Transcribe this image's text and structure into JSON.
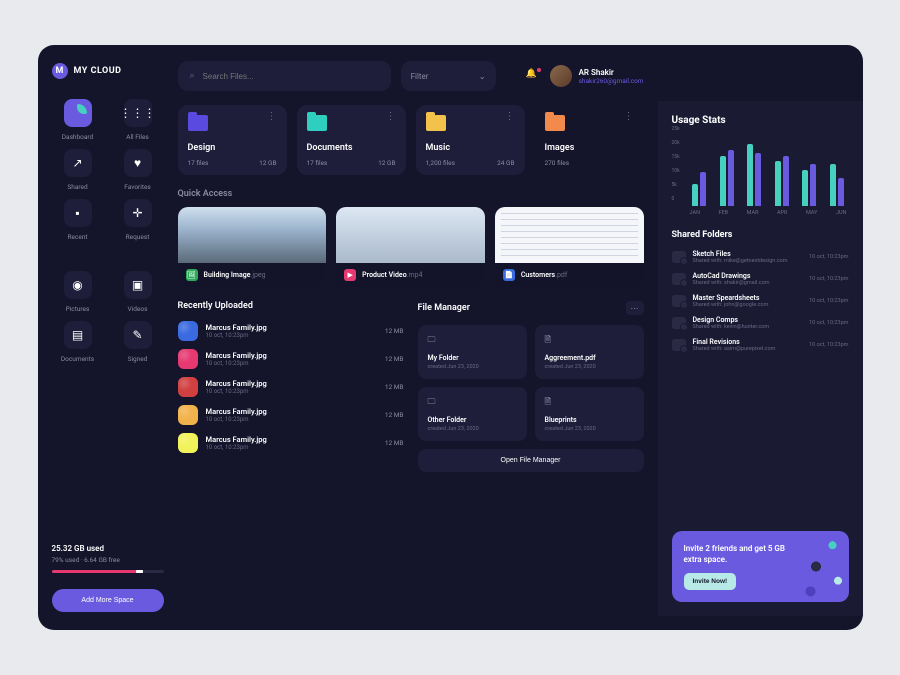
{
  "brand": {
    "initial": "M",
    "name": "MY CLOUD"
  },
  "nav": [
    {
      "label": "Dashboard",
      "glyph": "◧",
      "active": true
    },
    {
      "label": "All Files",
      "glyph": "⋮⋮⋮"
    },
    {
      "label": "Shared",
      "glyph": "↗"
    },
    {
      "label": "Favorites",
      "glyph": "♥"
    },
    {
      "label": "Recent",
      "glyph": "▪"
    },
    {
      "label": "Request",
      "glyph": "✛"
    },
    {
      "label": "Pictures",
      "glyph": "◉"
    },
    {
      "label": "Videos",
      "glyph": "▣"
    },
    {
      "label": "Documents",
      "glyph": "▤"
    },
    {
      "label": "Signed",
      "glyph": "✎"
    }
  ],
  "storage": {
    "used": "25.32 GB used",
    "detail": "79% used · 6.64 GB free",
    "percent": 79,
    "add_label": "Add More Space"
  },
  "search": {
    "placeholder": "Search Files..."
  },
  "filter": {
    "label": "Filter"
  },
  "user": {
    "name": "AR Shakir",
    "email": "shakir260@gmail.com"
  },
  "folders": [
    {
      "name": "Design",
      "files": "17 files",
      "size": "12 GB",
      "color": "#5a4ae0"
    },
    {
      "name": "Documents",
      "files": "17 files",
      "size": "12 GB",
      "color": "#2ecfbf"
    },
    {
      "name": "Music",
      "files": "1,200 files",
      "size": "24 GB",
      "color": "#f2c24b"
    },
    {
      "name": "Images",
      "files": "270 files",
      "size": "",
      "color": "#f28a4b"
    }
  ],
  "quick_access": {
    "title": "Quick Access",
    "items": [
      {
        "name": "Building Image",
        "ext": ".jpeg",
        "badge_color": "#2eaa5a",
        "badge_glyph": "🖼"
      },
      {
        "name": "Product Video",
        "ext": ".mp4",
        "badge_color": "#e63971",
        "badge_glyph": "▶"
      },
      {
        "name": "Customers",
        "ext": ".pdf",
        "badge_color": "#3a6ae0",
        "badge_glyph": "📄"
      }
    ]
  },
  "recent": {
    "title": "Recently Uploaded",
    "items": [
      {
        "name": "Marcus Family.jpg",
        "meta": "10 oct, 10:23pm",
        "size": "12 MB",
        "thumb": "#3a6ae0"
      },
      {
        "name": "Marcus Family.jpg",
        "meta": "10 oct, 10:23pm",
        "size": "12 MB",
        "thumb": "#e63971"
      },
      {
        "name": "Marcus Family.jpg",
        "meta": "10 oct, 10:23pm",
        "size": "12 MB",
        "thumb": "#d04040"
      },
      {
        "name": "Marcus Family.jpg",
        "meta": "10 oct, 10:23pm",
        "size": "12 MB",
        "thumb": "#f2b24b"
      },
      {
        "name": "Marcus Family.jpg",
        "meta": "10 oct, 10:23pm",
        "size": "12 MB",
        "thumb": "#f2f25a"
      }
    ]
  },
  "file_manager": {
    "title": "File Manager",
    "items": [
      {
        "name": "My Folder",
        "sub": "created Jun 23, 2020",
        "glyph": "🗀"
      },
      {
        "name": "Aggreement.pdf",
        "sub": "created Jun 23, 2020",
        "glyph": "🗎"
      },
      {
        "name": "Other Folder",
        "sub": "created Jun 23, 2020",
        "glyph": "🗀"
      },
      {
        "name": "Blueprints",
        "sub": "created Jun 23, 2020",
        "glyph": "🗎"
      }
    ],
    "open_label": "Open File Manager"
  },
  "usage": {
    "title": "Usage Stats",
    "y_ticks": [
      "25k",
      "20k",
      "15k",
      "10k",
      "5k",
      "0"
    ],
    "x_labels": [
      "JAN",
      "FEB",
      "MAR",
      "APR",
      "MAY",
      "JUN"
    ]
  },
  "chart_data": {
    "type": "bar",
    "categories": [
      "JAN",
      "FEB",
      "MAR",
      "APR",
      "MAY",
      "JUN"
    ],
    "series": [
      {
        "name": "Series A",
        "color": "#47cfc0",
        "values": [
          8000,
          18000,
          22000,
          16000,
          13000,
          15000
        ]
      },
      {
        "name": "Series B",
        "color": "#6a5ae0",
        "values": [
          12000,
          20000,
          19000,
          18000,
          15000,
          10000
        ]
      }
    ],
    "ylim": [
      0,
      25000
    ],
    "ylabel": "",
    "xlabel": "",
    "title": "Usage Stats"
  },
  "shared": {
    "title": "Shared Folders",
    "items": [
      {
        "name": "Sketch Files",
        "sub": "Shared with: mike@getnextdesign.com",
        "time": "10 oct, 10:23pm"
      },
      {
        "name": "AutoCad Drawings",
        "sub": "Shared with: shakir@gmail.com",
        "time": "10 oct, 10:23pm"
      },
      {
        "name": "Master Speardsheets",
        "sub": "Shared with: john@google.com",
        "time": "10 oct, 10:23pm"
      },
      {
        "name": "Design Comps",
        "sub": "Shared with: kevin@hunter.com",
        "time": "10 oct, 10:23pm"
      },
      {
        "name": "Final Revisions",
        "sub": "Shared with: asim@purepixel.com",
        "time": "10 oct, 10:23pm"
      }
    ]
  },
  "invite": {
    "text": "Invite 2 friends and get 5 GB extra space.",
    "button": "Invite Now!"
  }
}
